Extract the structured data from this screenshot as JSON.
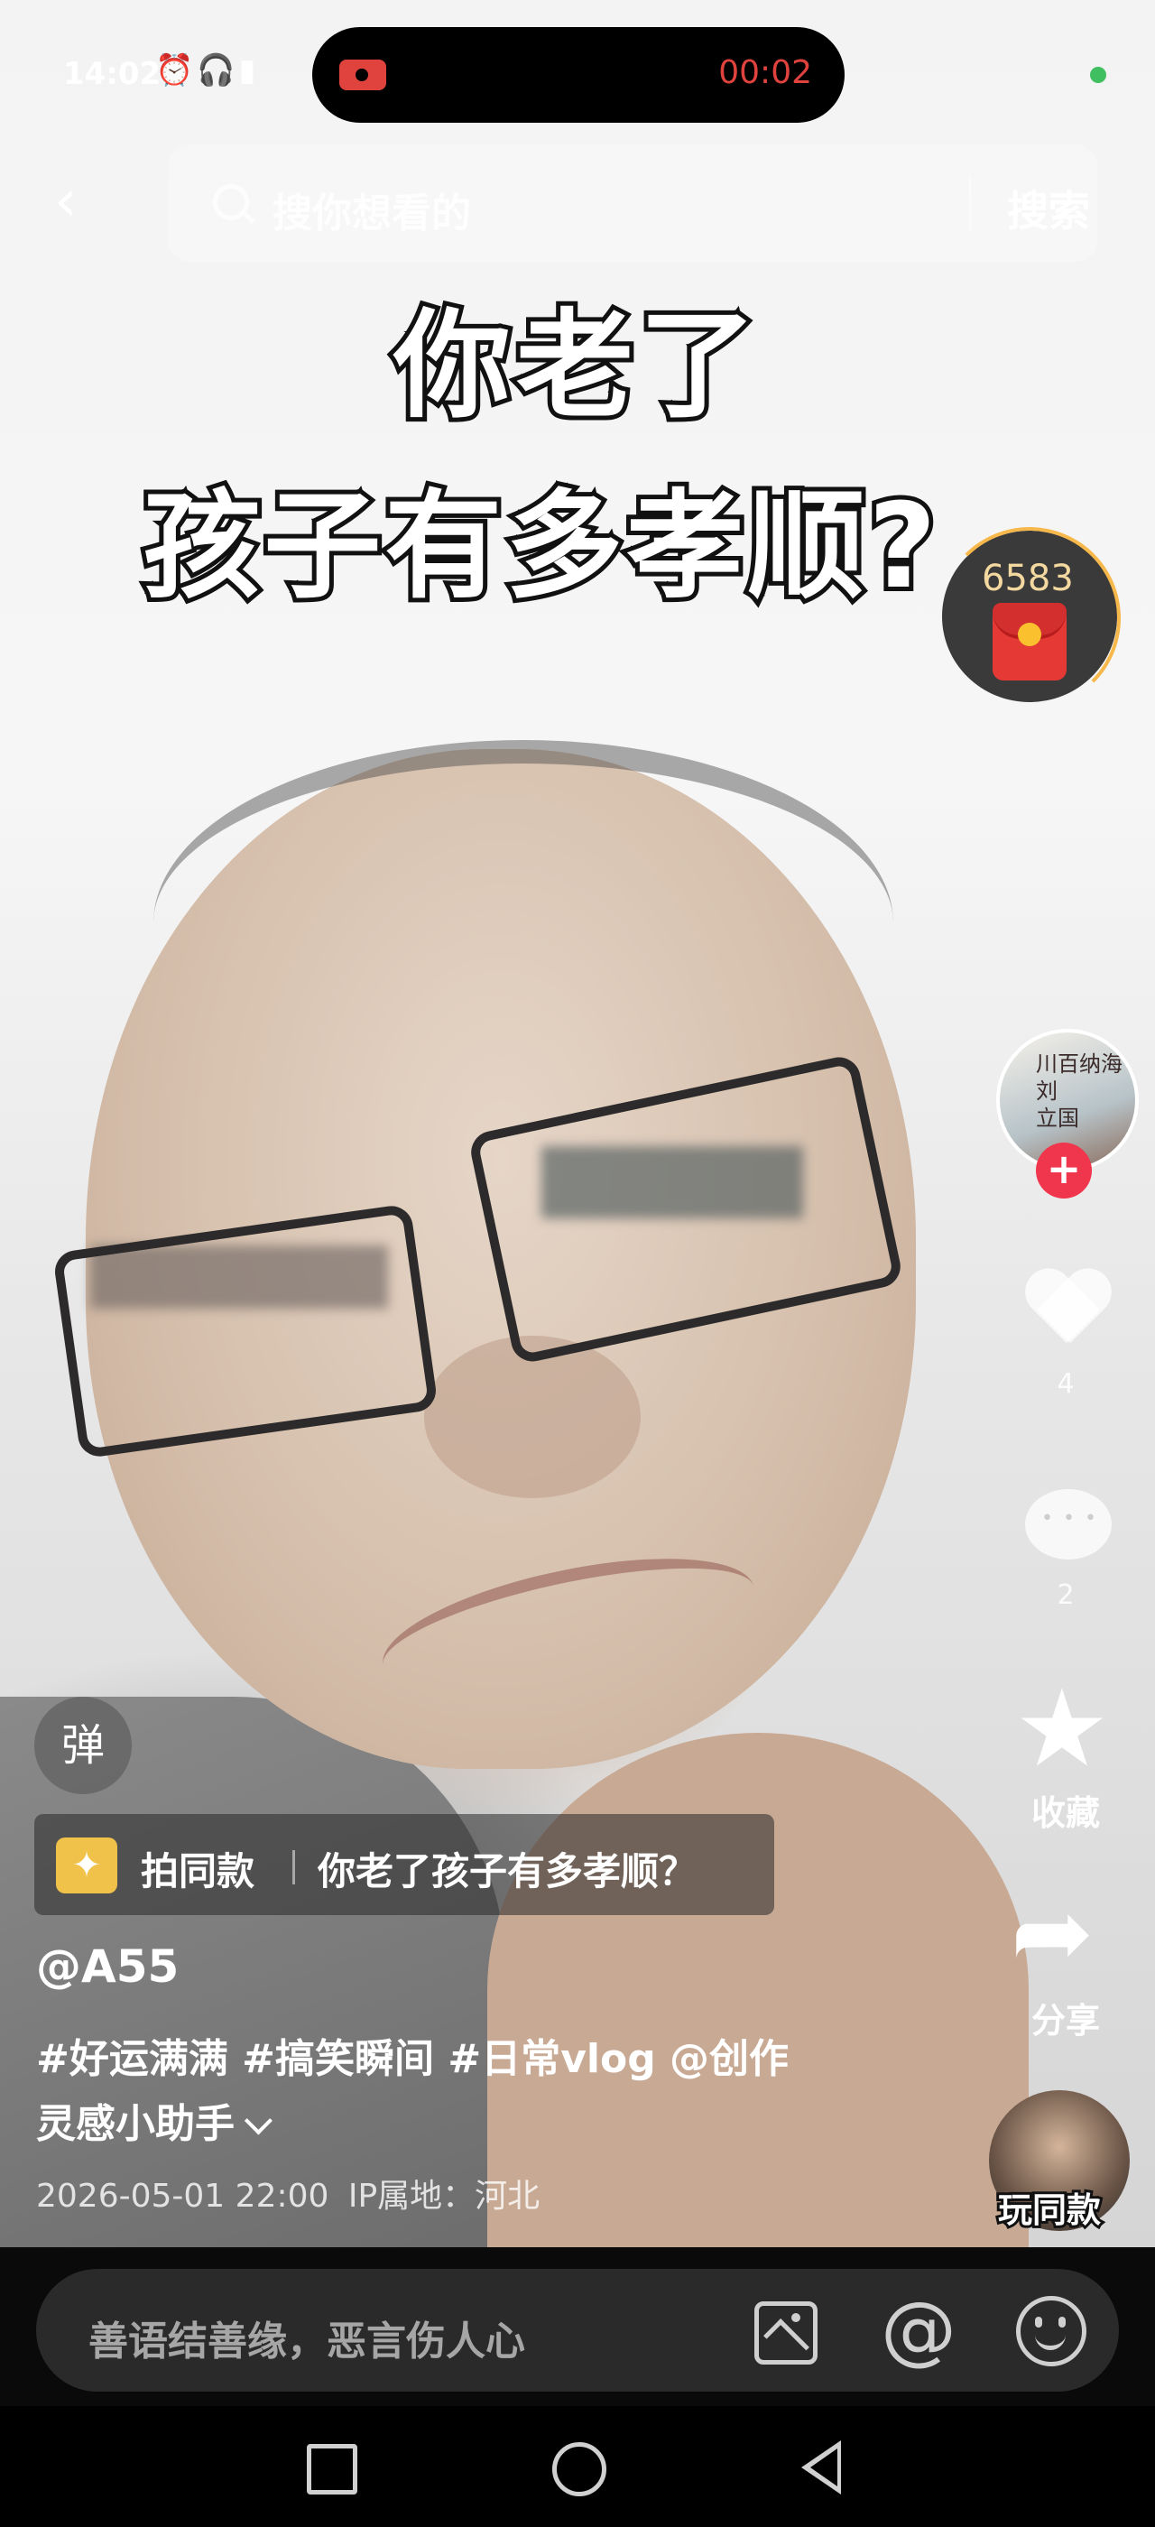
{
  "status_bar": {
    "time": "14:02",
    "icons": "⏰🎧▮",
    "recording_time": "00:02"
  },
  "search": {
    "placeholder": "搜你想看的",
    "button": "搜索"
  },
  "video": {
    "caption_line1": "你老了",
    "caption_line2": "孩子有多孝顺?"
  },
  "red_packet": {
    "count": "6583"
  },
  "sidebar": {
    "avatar_text": "川百纳海\n刘\n立国",
    "like_count": "4",
    "comment_count": "2",
    "favorite_label": "收藏",
    "share_label": "分享",
    "play_same_label": "玩同款"
  },
  "danmu": {
    "label": "弹"
  },
  "same_template": {
    "label": "拍同款",
    "title": "你老了孩子有多孝顺？"
  },
  "post": {
    "author": "@A55",
    "hashtags_line1": "#好运满满 #搞笑瞬间 #日常vlog @创作",
    "hashtags_line2": "灵感小助手",
    "datetime": "2026-05-01 22:00",
    "ip_location": "IP属地：河北"
  },
  "comment_bar": {
    "placeholder": "善语结善缘，恶言伤人心",
    "at_symbol": "@"
  },
  "colors": {
    "accent_red": "#f0364d",
    "recording_red": "#e0433e",
    "gold": "#f1c249"
  }
}
